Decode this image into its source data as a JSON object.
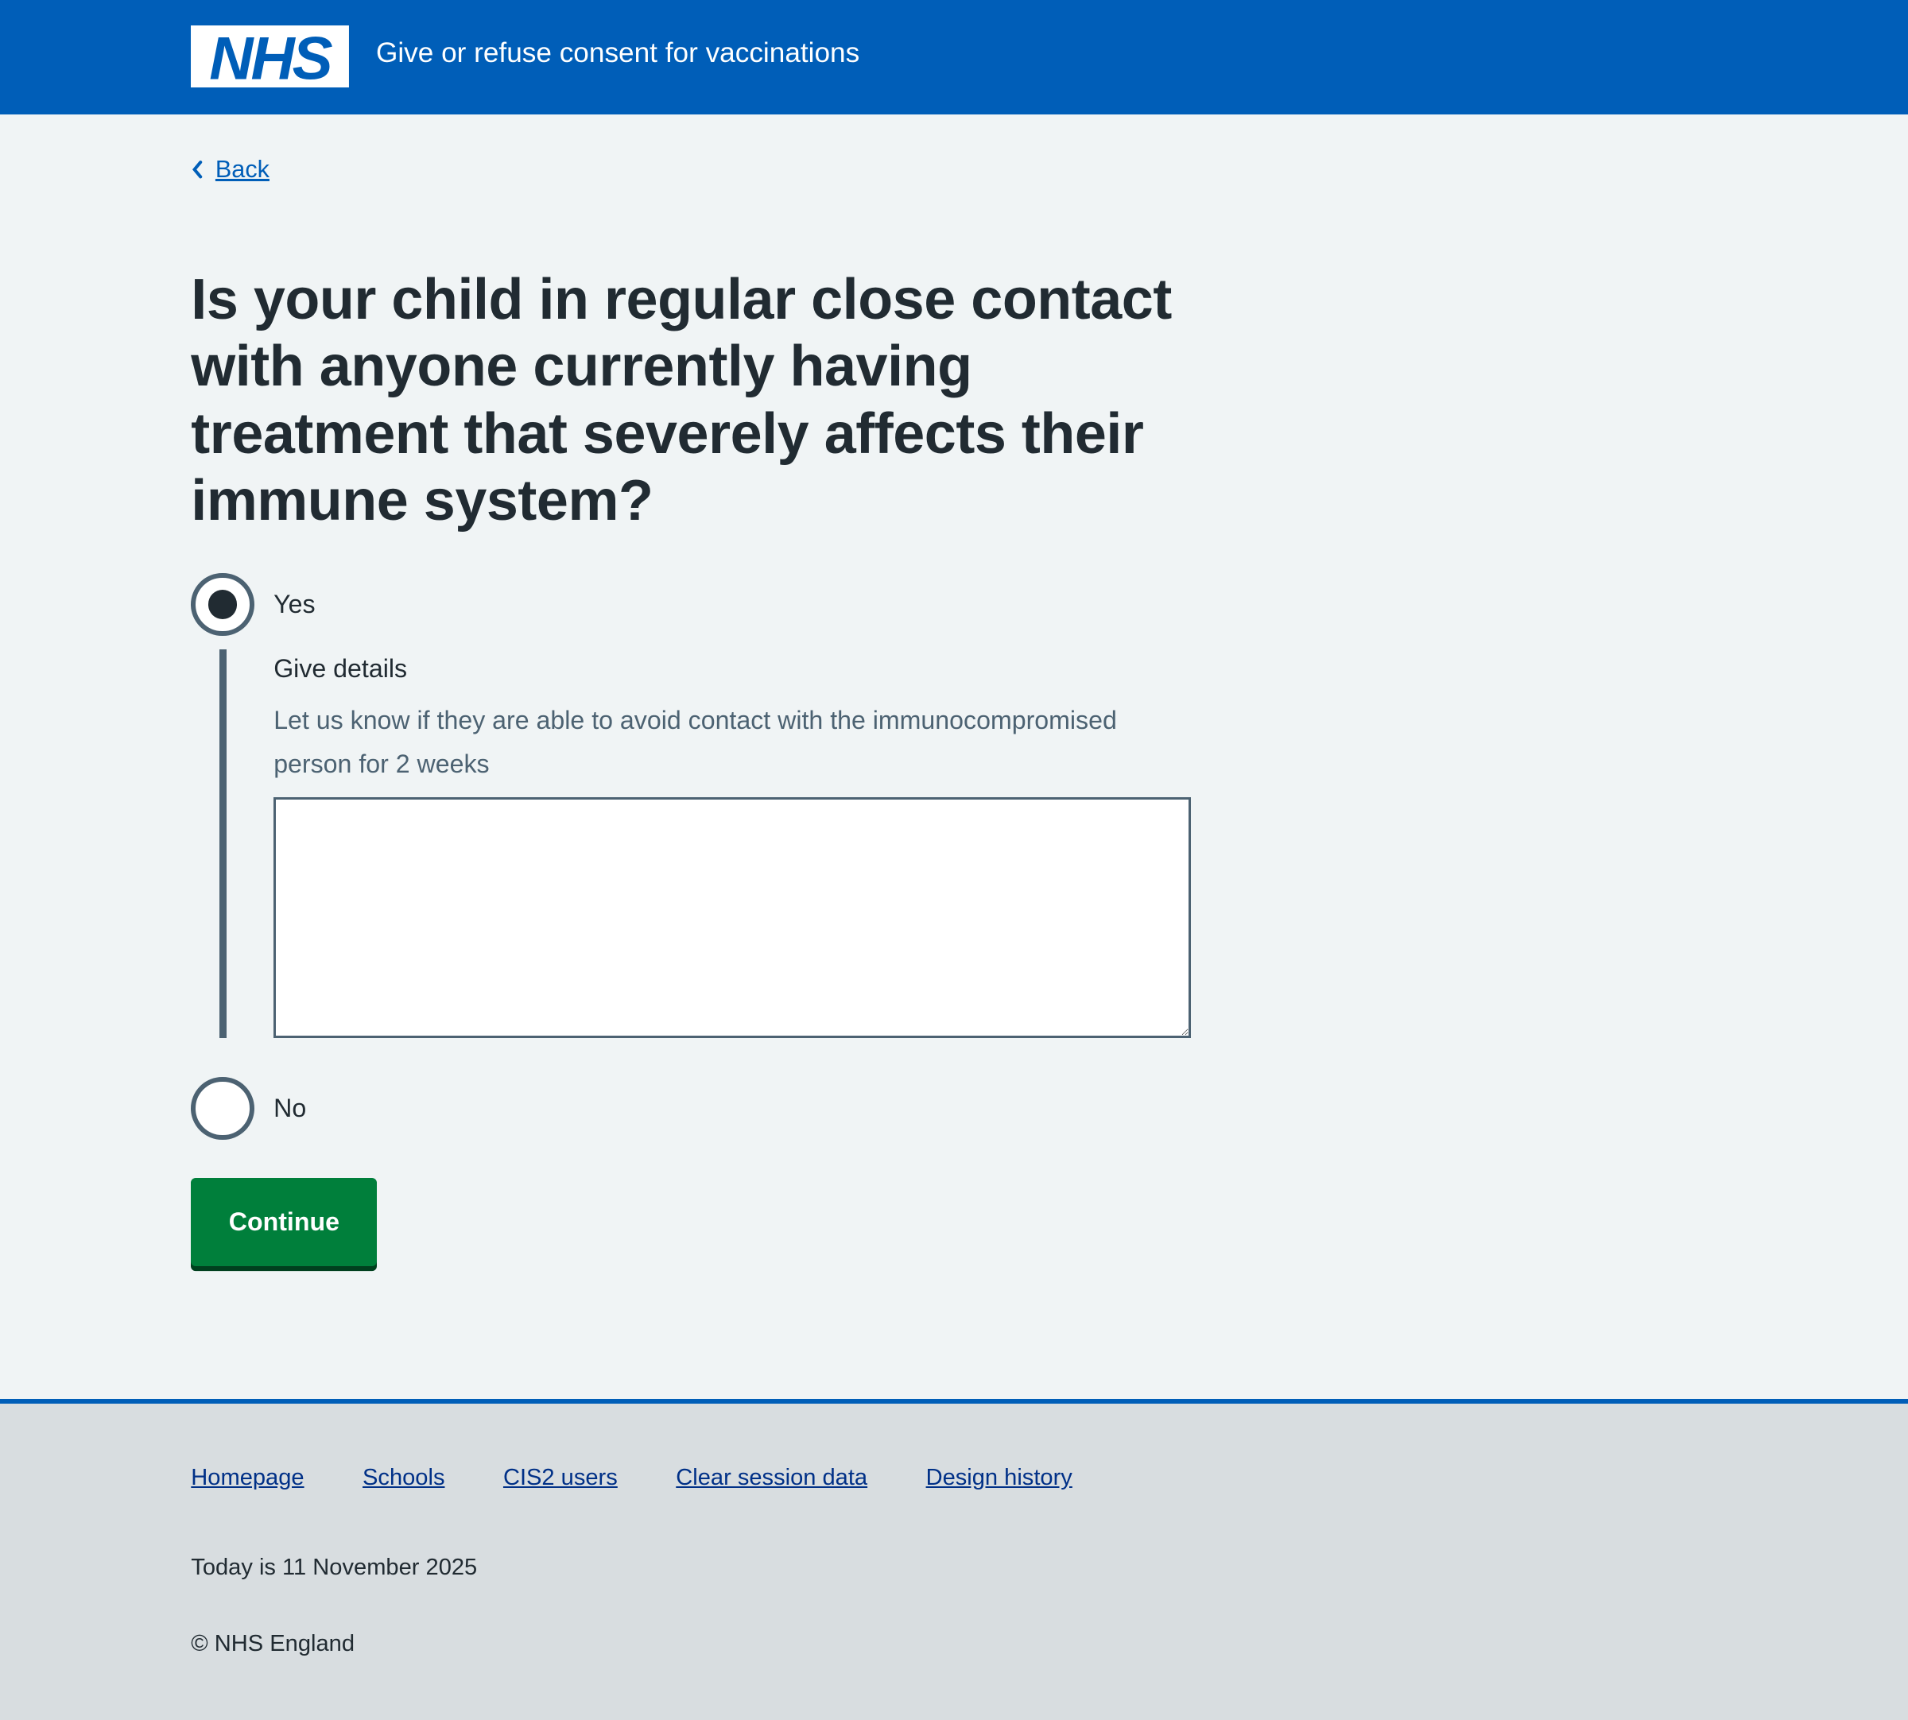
{
  "header": {
    "logo_text": "NHS",
    "service_name": "Give or refuse consent for vaccinations"
  },
  "back_label": "Back",
  "question": "Is your child in regular close contact with anyone currently having treatment that severely affects their immune system?",
  "options": [
    {
      "label": "Yes",
      "selected": true
    },
    {
      "label": "No",
      "selected": false
    }
  ],
  "details": {
    "label": "Give details",
    "hint": "Let us know if they are able to avoid contact with the immunocompromised person for 2 weeks",
    "value": ""
  },
  "continue_label": "Continue",
  "footer": {
    "links": [
      "Homepage",
      "Schools",
      "CIS2 users",
      "Clear session data",
      "Design history"
    ],
    "today": "Today is 11 November 2025",
    "copyright": "© NHS England"
  },
  "colors": {
    "brand": "#005eb8",
    "button": "#007f3b",
    "text": "#212b32",
    "secondary": "#4c6272"
  }
}
